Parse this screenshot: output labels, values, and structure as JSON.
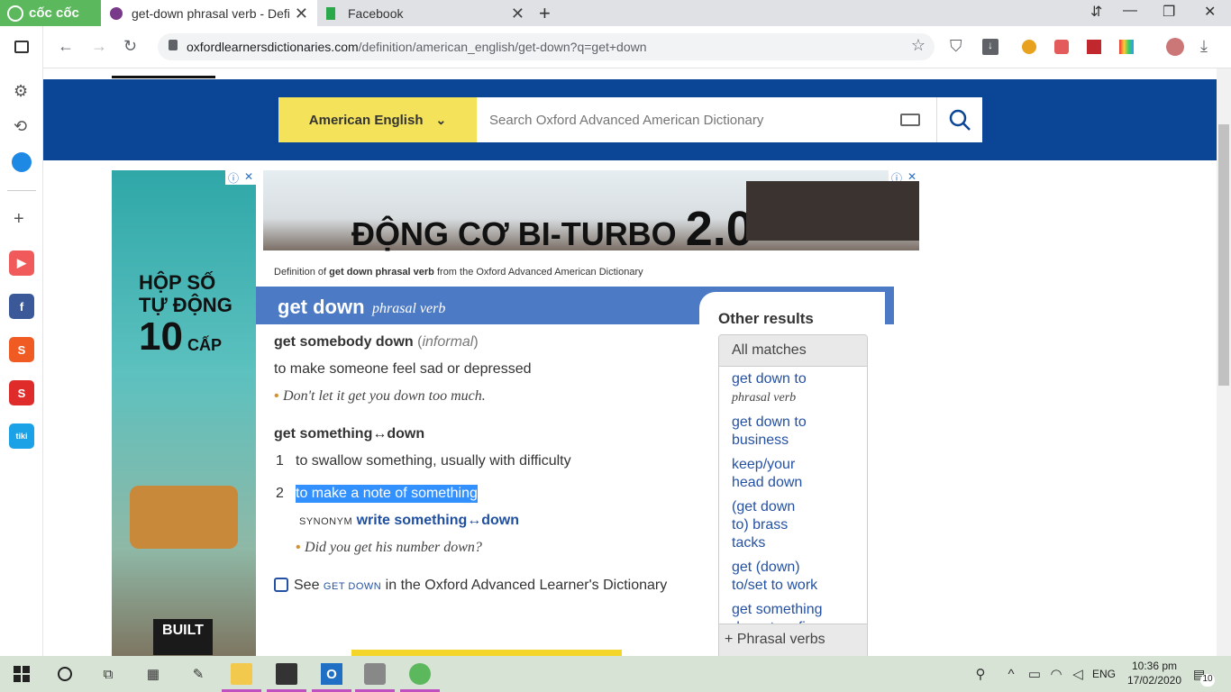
{
  "browser": {
    "brand": "cốc cốc",
    "tabs": [
      {
        "title": "get-down phrasal verb - Defi"
      },
      {
        "title": "Facebook"
      }
    ],
    "new_tab": "+",
    "window_buttons": [
      "⇵",
      "—",
      "❐",
      "✕"
    ],
    "url_domain": "oxfordlearnersdictionaries.com",
    "url_path": "/definition/american_english/get-down?q=get+down"
  },
  "site": {
    "dictionary_selector": "American English",
    "search_placeholder": "Search Oxford Advanced American Dictionary"
  },
  "ads": {
    "left_ad": {
      "line1": "HỘP SỐ",
      "line2": "TỰ ĐỘNG",
      "line3_num": "10",
      "line3_word": "CẤP",
      "badge": "BUILT"
    },
    "top_ad": {
      "text": "ĐỘNG CƠ BI-TURBO",
      "num": "2.0"
    }
  },
  "entry": {
    "definition_of_prefix": "Definition of",
    "definition_of_word": "get down phrasal verb",
    "definition_of_suffix": "from the Oxford Advanced American Dictionary",
    "headword": "get down",
    "pos": "phrasal verb",
    "sense1_phrase": "get somebody down",
    "sense1_label_open": "(",
    "sense1_label": "informal",
    "sense1_label_close": ")",
    "sense1_def": "to make someone feel sad or depressed",
    "sense1_example": "Don't let it get you down too much.",
    "sense2_phrase": "get something↔down",
    "sense2_num1": "1",
    "sense2_def1": "to swallow something, usually with difficulty",
    "sense2_num2": "2",
    "sense2_def2": "to make a note of something",
    "synonym_label": "SYNONYM",
    "synonym_word": "write something↔down",
    "sense2_example": "Did you get his number down?",
    "see_prefix": "See",
    "see_link": "GET DOWN",
    "see_suffix": "in the Oxford Advanced Learner's Dictionary"
  },
  "other_results": {
    "title": "Other results",
    "all_matches": "All matches",
    "items": [
      {
        "text": "get down to",
        "sub": "phrasal verb"
      },
      {
        "text": "get down to business"
      },
      {
        "text": "keep/your head down"
      },
      {
        "text": "(get down to) brass tacks"
      },
      {
        "text": "get (down) to/set to work"
      },
      {
        "text": "get something down to a fine art"
      }
    ],
    "phrasal_verbs": "Phrasal verbs"
  },
  "taskbar": {
    "language": "ENG",
    "time": "10:36 pm",
    "date": "17/02/2020",
    "notifications": "10"
  },
  "colors": {
    "oxford_blue": "#0b4596",
    "headword_bar": "#4c7ac5",
    "selector_yellow": "#f4e35a",
    "link_blue": "#2451a4",
    "coccoc_green": "#5cb85c"
  }
}
